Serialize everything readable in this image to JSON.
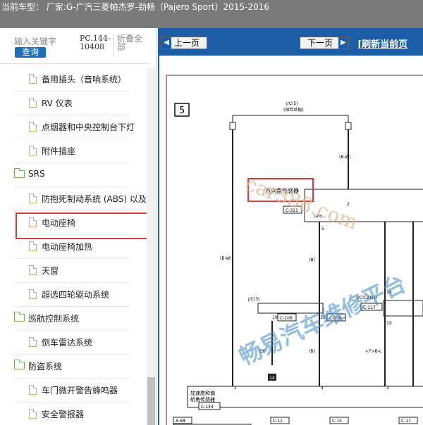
{
  "window": {
    "title": "当前车型：  厂家:G-广汽三菱帕杰罗-劲畅（Pajero Sport）2015-2016"
  },
  "sidebar": {
    "search_placeholder": "输入关键字",
    "search_button": "查询",
    "pc_code": "PC.144-10408",
    "collapse_all": "折叠全部",
    "items": [
      {
        "type": "leaf",
        "label": "备用插头（音响系统）"
      },
      {
        "type": "leaf",
        "label": "RV 仪表"
      },
      {
        "type": "leaf",
        "label": "点烟器和中央控制台下灯"
      },
      {
        "type": "leaf",
        "label": "附件插座"
      },
      {
        "type": "folder",
        "label": "SRS"
      },
      {
        "type": "leaf",
        "label": "防抱死制动系统 (ABS) 以及主动"
      },
      {
        "type": "leaf",
        "label": "电动座椅"
      },
      {
        "type": "leaf",
        "label": "电动座椅加热"
      },
      {
        "type": "leaf",
        "label": "天窗"
      },
      {
        "type": "leaf",
        "label": "超选四轮驱动系统"
      },
      {
        "type": "folder",
        "label": "巡航控制系统"
      },
      {
        "type": "leaf",
        "label": "倒车雷达系统"
      },
      {
        "type": "folder",
        "label": "防盗系统"
      },
      {
        "type": "leaf",
        "label": "车门微开警告蜂鸣器"
      },
      {
        "type": "leaf",
        "label": "安全警报器"
      }
    ]
  },
  "toolbar": {
    "prev_label": "上一页",
    "next_label": "下一页",
    "refresh_label": "[刷新当前页"
  },
  "diagram": {
    "page_number": "5",
    "jc5": "J/C(5)",
    "fuse": "(保险丝板)",
    "bw": "(B-W)",
    "sensor_label": "方向盘传感器",
    "c311": "C-311",
    "gnd": "GND",
    "pin5": "5",
    "pin2": "2",
    "pin1": "1",
    "pin3": "3",
    "b": "(B)",
    "jc3": "J/C(3)",
    "jccan1": "J/C(CAN1)",
    "c117": "C-117",
    "c106": "C-106",
    "pin19": "19",
    "pin13": "13",
    "pin14": "14",
    "pin15": "15",
    "pin4": "4",
    "ground_14": "14",
    "bl": "<T>B-L",
    "accel_label_1": "加速度和偏",
    "accel_label_2": "航角传感器",
    "c144": "C-144",
    "a68": "A-68",
    "c11": "C-11",
    "c15": "C-15",
    "c17": "C-17",
    "watermark_1": "car388.com",
    "watermark_2": "畅易汽车维修平台"
  }
}
